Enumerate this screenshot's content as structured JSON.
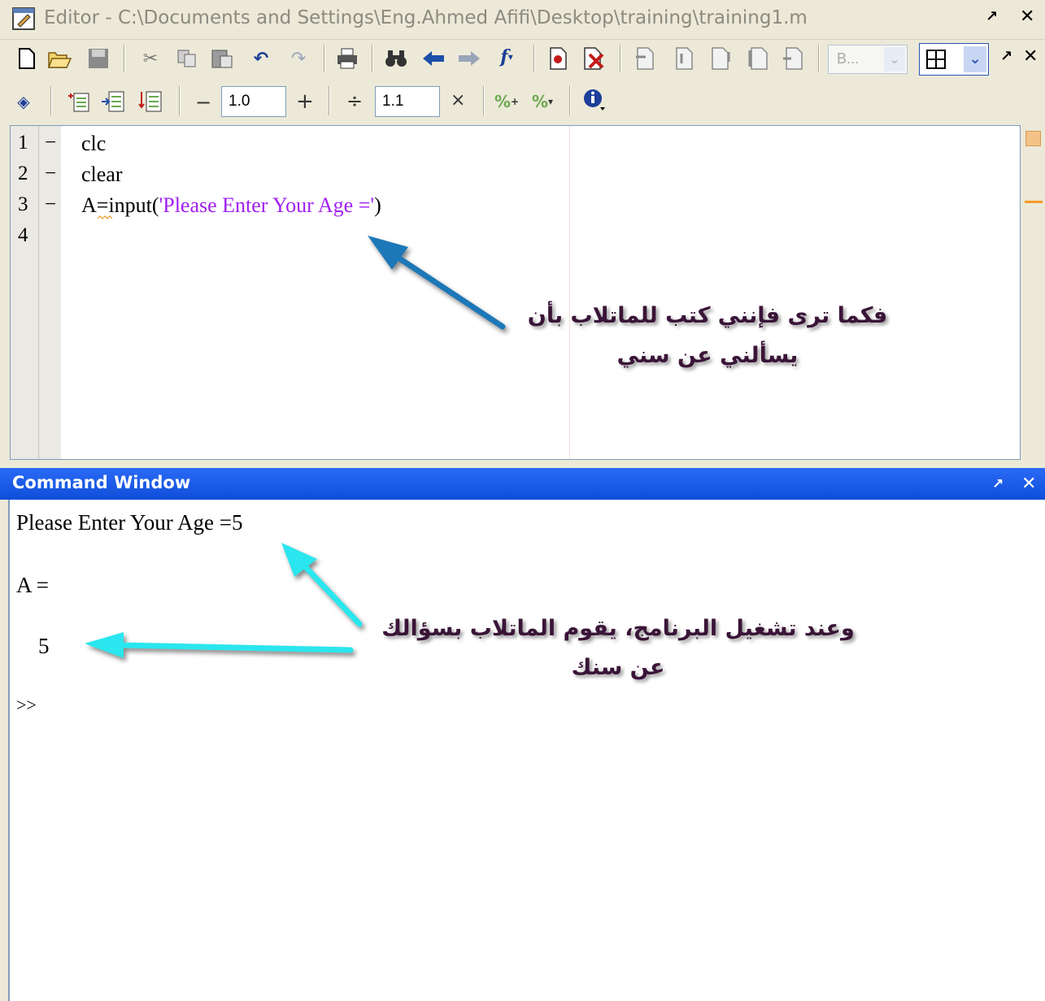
{
  "editor": {
    "title": "Editor - C:\\Documents and Settings\\Eng.Ahmed Afifi\\Desktop\\training\\training1.m",
    "undock_label": "↗",
    "close_label": "✕",
    "font_select": "B...",
    "cell_toolbar": {
      "minus": "−",
      "decrement_value": "1.0",
      "plus": "+",
      "divide": "÷",
      "multiply_value": "1.1",
      "times": "×"
    },
    "lines": [
      {
        "number": "1",
        "dash": "−",
        "code": "clc"
      },
      {
        "number": "2",
        "dash": "−",
        "code": "clear"
      },
      {
        "number": "3",
        "dash": "−",
        "code_prefix": "A=input(",
        "code_string": "'Please Enter Your Age ='",
        "code_suffix": ")"
      },
      {
        "number": "4",
        "dash": "",
        "code": ""
      }
    ],
    "annotation_line1": "فكما ترى فإنني كتب للماتلاب بأن",
    "annotation_line2": "يسألني عن سني"
  },
  "command_window": {
    "title": "Command Window",
    "undock_label": "↗",
    "close_label": "✕",
    "lines": [
      "Please Enter Your Age =5",
      "A =",
      "    5",
      ">>"
    ],
    "annotation_line1": "وعند تشغيل البرنامج، يقوم الماتلاب بسؤالك",
    "annotation_line2": "عن سنك"
  },
  "colors": {
    "string": "#a020f0",
    "titlebar_blue": "#1e5ff0",
    "arrow_blue": "#1b78b8",
    "arrow_cyan": "#29e6ee",
    "annotation_text": "#3a1438"
  }
}
